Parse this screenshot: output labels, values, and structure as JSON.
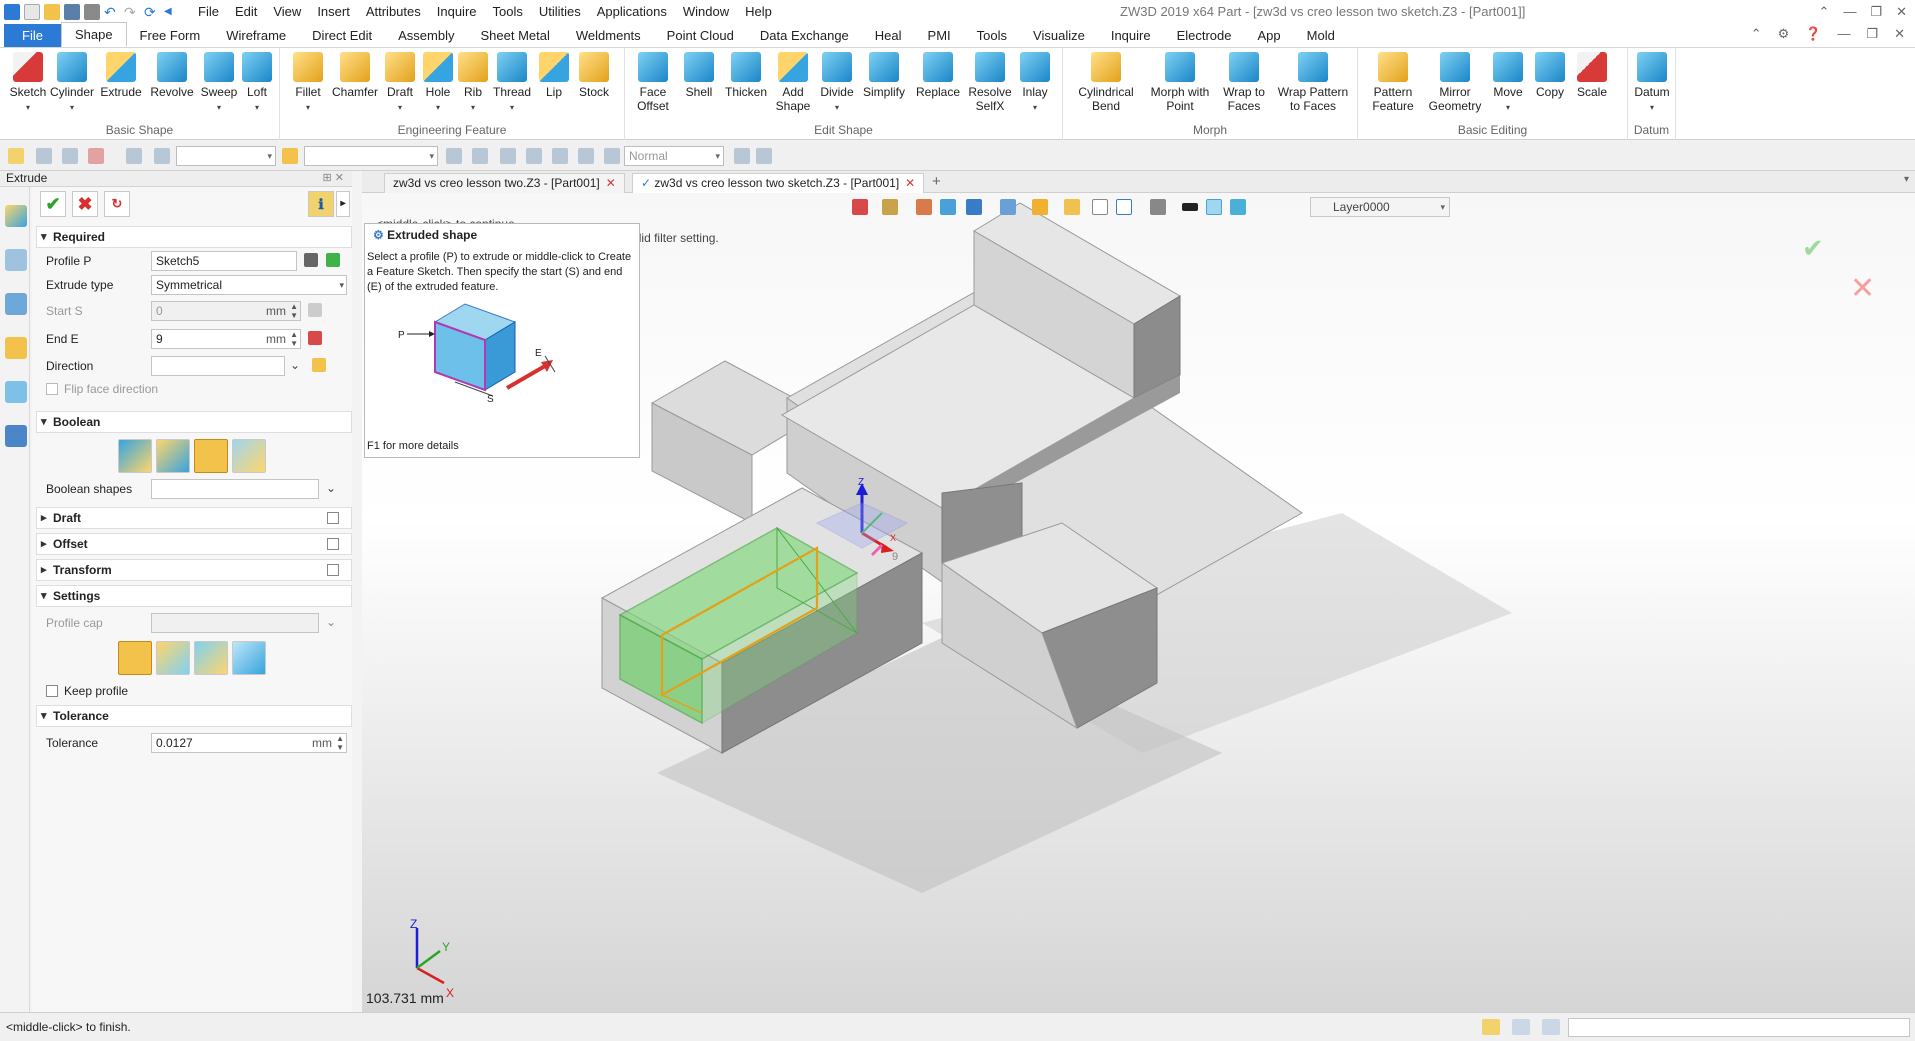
{
  "window": {
    "title": "ZW3D 2019  x64      Part - [zw3d vs creo lesson two sketch.Z3 - [Part001]]"
  },
  "menu": [
    "File",
    "Edit",
    "View",
    "Insert",
    "Attributes",
    "Inquire",
    "Tools",
    "Utilities",
    "Applications",
    "Window",
    "Help"
  ],
  "ribbon_tabs": [
    "File",
    "Shape",
    "Free Form",
    "Wireframe",
    "Direct Edit",
    "Assembly",
    "Sheet Metal",
    "Weldments",
    "Point Cloud",
    "Data Exchange",
    "Heal",
    "PMI",
    "Tools",
    "Visualize",
    "Inquire",
    "Electrode",
    "App",
    "Mold"
  ],
  "ribbon_groups": [
    {
      "label": "Basic Shape",
      "buttons": [
        {
          "label": "Sketch",
          "icon": "sketch-icon"
        },
        {
          "label": "Cylinder",
          "icon": "cylinder-icon"
        },
        {
          "label": "Extrude",
          "icon": "extrude-icon"
        },
        {
          "label": "Revolve",
          "icon": "revolve-icon"
        },
        {
          "label": "Sweep",
          "icon": "sweep-icon"
        },
        {
          "label": "Loft",
          "icon": "loft-icon"
        }
      ]
    },
    {
      "label": "Engineering Feature",
      "buttons": [
        {
          "label": "Fillet",
          "icon": "fillet-icon"
        },
        {
          "label": "Chamfer",
          "icon": "chamfer-icon"
        },
        {
          "label": "Draft",
          "icon": "draft-icon"
        },
        {
          "label": "Hole",
          "icon": "hole-icon"
        },
        {
          "label": "Rib",
          "icon": "rib-icon"
        },
        {
          "label": "Thread",
          "icon": "thread-icon"
        },
        {
          "label": "Lip",
          "icon": "lip-icon"
        },
        {
          "label": "Stock",
          "icon": "stock-icon"
        }
      ]
    },
    {
      "label": "Edit Shape",
      "buttons": [
        {
          "label": "Face\nOffset",
          "icon": "face-offset-icon"
        },
        {
          "label": "Shell",
          "icon": "shell-icon"
        },
        {
          "label": "Thicken",
          "icon": "thicken-icon"
        },
        {
          "label": "Add\nShape",
          "icon": "add-shape-icon"
        },
        {
          "label": "Divide",
          "icon": "divide-icon"
        },
        {
          "label": "Simplify",
          "icon": "simplify-icon"
        },
        {
          "label": "Replace",
          "icon": "replace-icon"
        },
        {
          "label": "Resolve\nSelfX",
          "icon": "resolve-selfx-icon"
        },
        {
          "label": "Inlay",
          "icon": "inlay-icon"
        }
      ]
    },
    {
      "label": "Morph",
      "buttons": [
        {
          "label": "Cylindrical\nBend",
          "icon": "cylindrical-bend-icon"
        },
        {
          "label": "Morph with\nPoint",
          "icon": "morph-point-icon"
        },
        {
          "label": "Wrap to\nFaces",
          "icon": "wrap-faces-icon"
        },
        {
          "label": "Wrap Pattern\nto Faces",
          "icon": "wrap-pattern-icon"
        }
      ]
    },
    {
      "label": "Basic Editing",
      "buttons": [
        {
          "label": "Pattern\nFeature",
          "icon": "pattern-icon"
        },
        {
          "label": "Mirror\nGeometry",
          "icon": "mirror-icon"
        },
        {
          "label": "Move",
          "icon": "move-icon"
        },
        {
          "label": "Copy",
          "icon": "copy-icon"
        },
        {
          "label": "Scale",
          "icon": "scale-icon"
        }
      ]
    },
    {
      "label": "Datum",
      "buttons": [
        {
          "label": "Datum",
          "icon": "datum-icon"
        }
      ]
    }
  ],
  "toolbar2": {
    "filter_value": "",
    "render_mode": "Normal"
  },
  "panel": {
    "title": "Extrude",
    "required_label": "Required",
    "profile_label": "Profile P",
    "profile_value": "Sketch5",
    "extrude_type_label": "Extrude type",
    "extrude_type_value": "Symmetrical",
    "start_label": "Start S",
    "start_value": "0",
    "start_unit": "mm",
    "end_label": "End E",
    "end_value": "9",
    "end_unit": "mm",
    "direction_label": "Direction",
    "direction_value": "",
    "flip_label": "Flip face direction",
    "boolean_label": "Boolean",
    "boolean_shapes_label": "Boolean shapes",
    "draft_label": "Draft",
    "offset_label": "Offset",
    "transform_label": "Transform",
    "settings_label": "Settings",
    "profile_cap_label": "Profile cap",
    "keep_profile_label": "Keep profile",
    "tolerance_section_label": "Tolerance",
    "tolerance_label": "Tolerance",
    "tolerance_value": "0.0127",
    "tolerance_unit": "mm"
  },
  "doc_tabs": [
    {
      "label": "zw3d vs creo lesson two.Z3 - [Part001]",
      "active": false
    },
    {
      "label": "zw3d vs creo lesson two sketch.Z3 - [Part001]",
      "active": true
    }
  ],
  "viewport": {
    "layer": "Layer0000",
    "hint": "<middle-click> to continue",
    "hint_overlap": "<Ctrl-Shift-Enter> to find most valid filter setting.",
    "tooltip_title": "Extruded shape",
    "tooltip_text": "Select a profile (P) to extrude or middle-click to Create a Feature Sketch. Then specify the start (S) and end (E) of the extruded feature.",
    "tooltip_foot": "F1 for more details",
    "diagram_labels": {
      "p": "P",
      "s": "S",
      "e": "E"
    },
    "measure": "103.731 mm",
    "dim_label": "9",
    "axis_labels": {
      "x": "X",
      "y": "Y",
      "z": "Z"
    }
  },
  "status": {
    "message": "<middle-click> to finish."
  },
  "colors": {
    "accent": "#2b7bd6",
    "extrude_preview": "#7fd87a",
    "profile_outline": "#e3a11a"
  }
}
